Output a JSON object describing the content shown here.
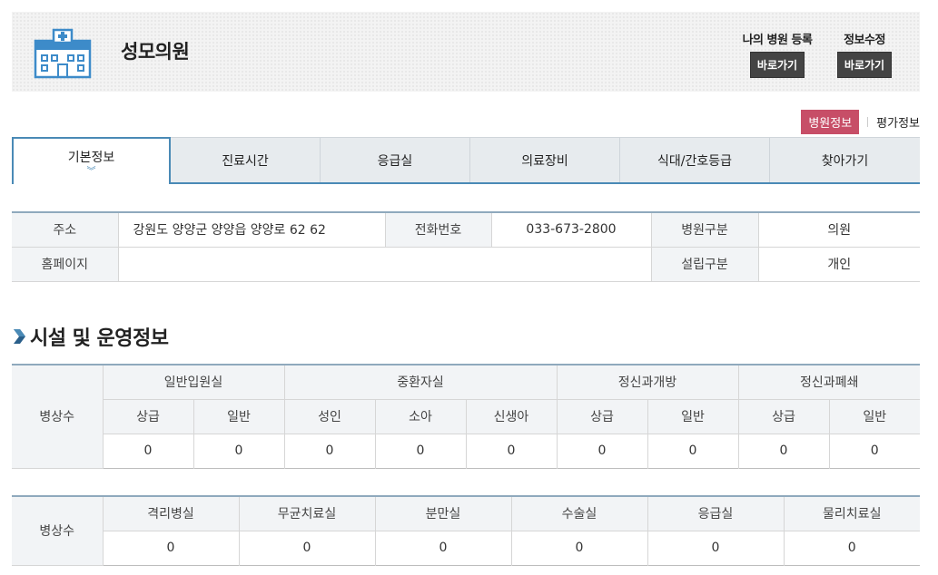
{
  "header": {
    "hospital_name": "성모의원",
    "register_label": "나의 병원 등록",
    "register_button": "바로가기",
    "edit_label": "정보수정",
    "edit_button": "바로가기"
  },
  "subtabs": {
    "active": "병원정보",
    "other": "평가정보"
  },
  "tabs": [
    "기본정보",
    "진료시간",
    "응급실",
    "의료장비",
    "식대/간호등급",
    "찾아가기"
  ],
  "info": {
    "address_label": "주소",
    "address": "강원도 양양군 양양읍 양양로 62 62",
    "phone_label": "전화번호",
    "phone": "033-673-2800",
    "type_label": "병원구분",
    "type": "의원",
    "homepage_label": "홈페이지",
    "homepage": "",
    "establish_label": "설립구분",
    "establish": "개인"
  },
  "section_title": "시설 및 운영정보",
  "beds1": {
    "row_label": "병상수",
    "groups": [
      "일반입원실",
      "중환자실",
      "정신과개방",
      "정신과폐쇄"
    ],
    "subs": [
      "상급",
      "일반",
      "성인",
      "소아",
      "신생아",
      "상급",
      "일반",
      "상급",
      "일반"
    ],
    "values": [
      "0",
      "0",
      "0",
      "0",
      "0",
      "0",
      "0",
      "0",
      "0"
    ]
  },
  "beds2": {
    "row_label": "병상수",
    "headers": [
      "격리병실",
      "무균치료실",
      "분만실",
      "수술실",
      "응급실",
      "물리치료실"
    ],
    "values": [
      "0",
      "0",
      "0",
      "0",
      "0",
      "0"
    ]
  }
}
